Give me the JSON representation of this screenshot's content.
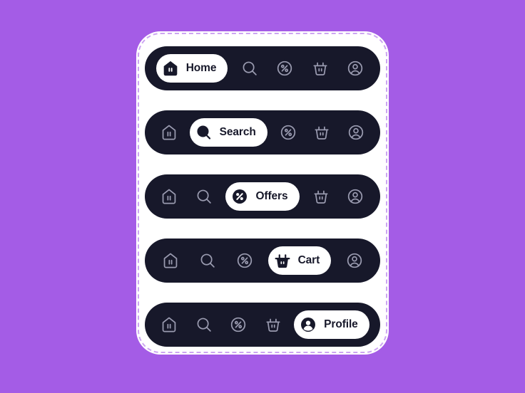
{
  "canvas": {
    "background_color": "#a45ce6",
    "card_color": "#ffffff",
    "bar_color": "#17182a",
    "active_pill_color": "#ffffff",
    "active_text_color": "#17182a",
    "inactive_icon_color": "#9a9bb0"
  },
  "navigation": {
    "items": [
      {
        "key": "home",
        "label": "Home",
        "icon": "house-icon"
      },
      {
        "key": "search",
        "label": "Search",
        "icon": "search-icon"
      },
      {
        "key": "offers",
        "label": "Offers",
        "icon": "percent-icon"
      },
      {
        "key": "cart",
        "label": "Cart",
        "icon": "basket-icon"
      },
      {
        "key": "profile",
        "label": "Profile",
        "icon": "person-icon"
      }
    ]
  },
  "bars": [
    {
      "index": 1,
      "active_key": "home",
      "active_label": "Home"
    },
    {
      "index": 2,
      "active_key": "search",
      "active_label": "Search"
    },
    {
      "index": 3,
      "active_key": "offers",
      "active_label": "Offers"
    },
    {
      "index": 4,
      "active_key": "cart",
      "active_label": "Cart"
    },
    {
      "index": 5,
      "active_key": "profile",
      "active_label": "Profile"
    }
  ]
}
